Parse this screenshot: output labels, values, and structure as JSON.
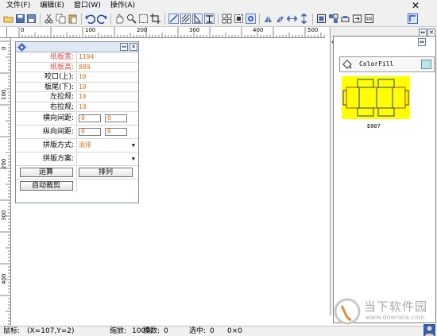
{
  "menubar": {
    "items": [
      "文件(F)",
      "编辑(E)",
      "窗口(W)",
      "操作(A)"
    ],
    "close": "✕"
  },
  "toolbar": {
    "icons": [
      "open-icon",
      "save-icon",
      "save-as-icon",
      "cut-icon",
      "copy-icon",
      "paste-icon",
      "undo-icon",
      "redo-icon",
      "hand-icon",
      "zoom-icon",
      "select-rect-icon",
      "crop-icon",
      "line-icon",
      "hatch-icon",
      "fold-icon",
      "layout-icon",
      "grid-icon",
      "center-icon",
      "settings-icon",
      "flip-icon",
      "mirror-icon",
      "stretch-icon",
      "height-icon",
      "frame-icon",
      "nest-icon",
      "bridge-icon",
      "export-icon",
      "special-icon"
    ]
  },
  "ruler": {
    "h_labels": [
      "0",
      "100",
      "200",
      "300",
      "400",
      "500"
    ],
    "v_labels": [
      "0",
      "100",
      "200",
      "300",
      "400"
    ]
  },
  "panel": {
    "rows": [
      {
        "label": "纸板宽:",
        "value": "1194",
        "style": "red"
      },
      {
        "label": "纸板高:",
        "value": "889",
        "style": "red"
      },
      {
        "label": "咬口(上):",
        "value": "10",
        "style": "normal"
      },
      {
        "label": "板尾(下):",
        "value": "10",
        "style": "normal"
      },
      {
        "label": "左拉规:",
        "value": "10",
        "style": "normal"
      },
      {
        "label": "右拉规:",
        "value": "10",
        "style": "normal"
      }
    ],
    "h_gap": {
      "label": "横向间距:",
      "v1": "0",
      "v2": "0"
    },
    "v_gap": {
      "label": "纵向间距:",
      "v1": "0",
      "v2": "0"
    },
    "layout_mode": {
      "label": "拼版方式:",
      "value": "混排"
    },
    "layout_plan": {
      "label": "拼版方案:",
      "value": ""
    },
    "calc_button": "运算",
    "arrange_button": "排列",
    "auto_cut_button": "自动裁剪"
  },
  "dock": {
    "colorfill_label": "ColorFill",
    "swatch_color": "#b9e6e8",
    "thumb_label": "E007"
  },
  "statusbar": {
    "mouse_label": "鼠标:",
    "mouse_value": "(X=107,Y=2)",
    "zoom_label": "缩放:",
    "zoom_value": "100%",
    "count_label": "模数:",
    "count_value": "0",
    "selected_label": "选中:",
    "selected_value": "0",
    "dims_value": "0×0"
  },
  "watermark": {
    "line1": "当下软件园",
    "line2": "www.downxia.com"
  },
  "colors": {
    "accent_orange": "#d6701e",
    "label_red": "#e04a4a",
    "thumb_yellow": "#ffff00"
  }
}
